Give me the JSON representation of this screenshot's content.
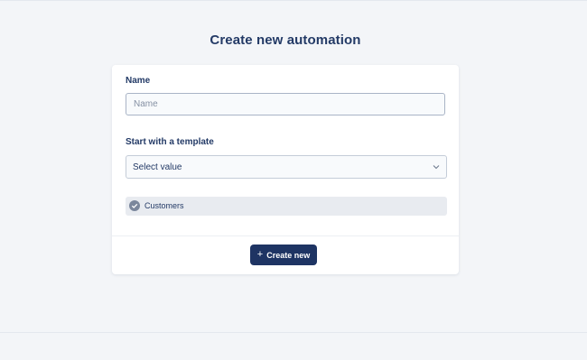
{
  "page": {
    "title": "Create new automation"
  },
  "form": {
    "name_label": "Name",
    "name_placeholder": "Name",
    "name_value": "",
    "template_label": "Start with a template",
    "template_selected": "Select value",
    "selected_tag": "Customers",
    "create_button_label": "Create new"
  },
  "icons": {
    "select": "chevron-down-icon",
    "tag": "check-circle-icon",
    "button": "plus-icon"
  },
  "colors": {
    "accent": "#1e3463",
    "title": "#233a66",
    "background": "#f3f5f8"
  }
}
